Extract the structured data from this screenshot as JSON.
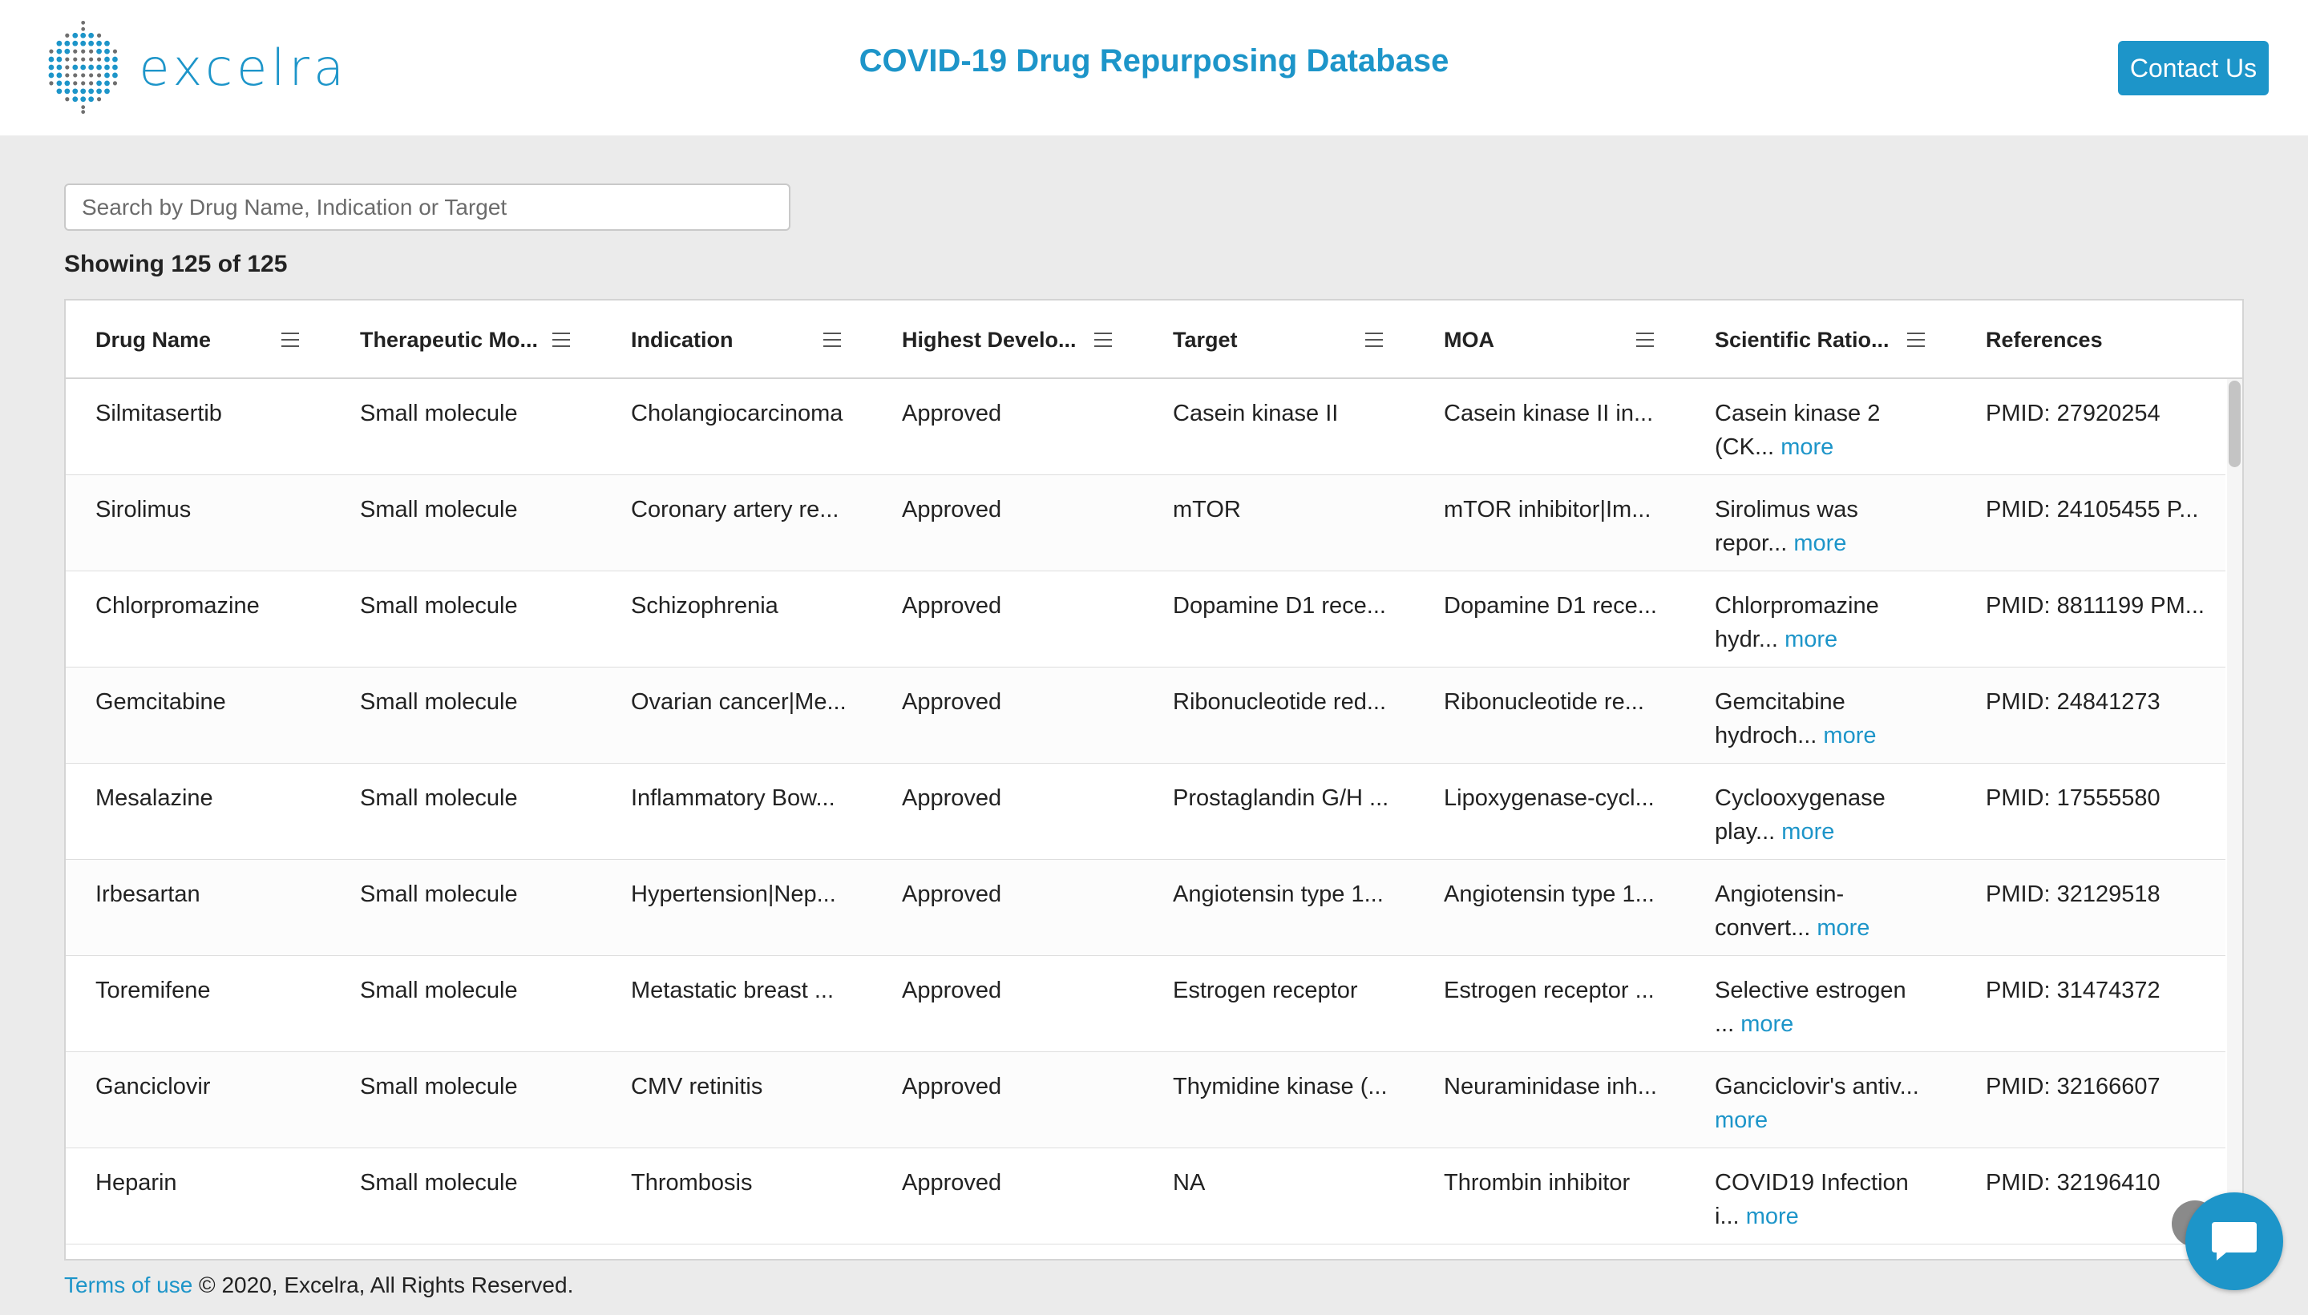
{
  "header": {
    "logo_text": "excelra",
    "title": "COVID-19 Drug Repurposing Database",
    "contact_label": "Contact Us"
  },
  "search": {
    "placeholder": "Search by Drug Name, Indication or Target",
    "value": ""
  },
  "showing_text": "Showing 125 of 125",
  "columns": [
    "Drug Name",
    "Therapeutic Mo...",
    "Indication",
    "Highest Develo...",
    "Target",
    "MOA",
    "Scientific Ratio...",
    "References"
  ],
  "more_label": "more",
  "rows": [
    {
      "drug": "Silmitasertib",
      "modality": "Small molecule",
      "indication": "Cholangiocarcinoma",
      "phase": "Approved",
      "target": "Casein kinase II",
      "moa": "Casein kinase II in...",
      "rationale_1": "Casein kinase 2",
      "rationale_2": "(CK...",
      "refs": "PMID: 27920254"
    },
    {
      "drug": "Sirolimus",
      "modality": "Small molecule",
      "indication": "Coronary artery re...",
      "phase": "Approved",
      "target": "mTOR",
      "moa": "mTOR inhibitor|Im...",
      "rationale_1": "Sirolimus was",
      "rationale_2": "repor...",
      "refs": "PMID: 24105455 P..."
    },
    {
      "drug": "Chlorpromazine",
      "modality": "Small molecule",
      "indication": "Schizophrenia",
      "phase": "Approved",
      "target": "Dopamine D1 rece...",
      "moa": "Dopamine D1 rece...",
      "rationale_1": "Chlorpromazine",
      "rationale_2": "hydr...",
      "refs": "PMID: 8811199 PM..."
    },
    {
      "drug": "Gemcitabine",
      "modality": "Small molecule",
      "indication": "Ovarian cancer|Me...",
      "phase": "Approved",
      "target": "Ribonucleotide red...",
      "moa": " Ribonucleotide re...",
      "rationale_1": "Gemcitabine",
      "rationale_2": "hydroch...",
      "refs": "PMID: 24841273"
    },
    {
      "drug": "Mesalazine",
      "modality": "Small molecule",
      "indication": "Inflammatory Bow...",
      "phase": "Approved",
      "target": "Prostaglandin G/H ...",
      "moa": "Lipoxygenase-cycl...",
      "rationale_1": "Cyclooxygenase",
      "rationale_2": "play...",
      "refs": "PMID: 17555580"
    },
    {
      "drug": "Irbesartan",
      "modality": "Small molecule",
      "indication": "Hypertension|Nep...",
      "phase": "Approved",
      "target": "Angiotensin type 1...",
      "moa": "Angiotensin type 1...",
      "rationale_1": "Angiotensin-",
      "rationale_2": "convert...",
      "refs": "PMID: 32129518"
    },
    {
      "drug": "Toremifene",
      "modality": "Small molecule",
      "indication": "Metastatic breast ...",
      "phase": "Approved",
      "target": "Estrogen receptor",
      "moa": "Estrogen receptor ...",
      "rationale_1": "Selective estrogen",
      "rationale_2": "...",
      "refs": "PMID: 31474372"
    },
    {
      "drug": "Ganciclovir",
      "modality": "Small molecule",
      "indication": "CMV retinitis",
      "phase": "Approved",
      "target": "Thymidine kinase (...",
      "moa": "Neuraminidase inh...",
      "rationale_1": "Ganciclovir's antiv...",
      "rationale_2": "",
      "refs": "PMID: 32166607"
    },
    {
      "drug": "Heparin",
      "modality": "Small molecule",
      "indication": "Thrombosis",
      "phase": "Approved",
      "target": "NA",
      "moa": "Thrombin inhibitor",
      "rationale_1": "COVID19 Infection",
      "rationale_2": "i...",
      "refs": "PMID: 32196410"
    }
  ],
  "footer": {
    "terms_label": "Terms of use",
    "copyright": " © 2020, Excelra, All Rights Reserved."
  },
  "colors": {
    "accent": "#1d95c9",
    "page_bg": "#ebebeb"
  }
}
